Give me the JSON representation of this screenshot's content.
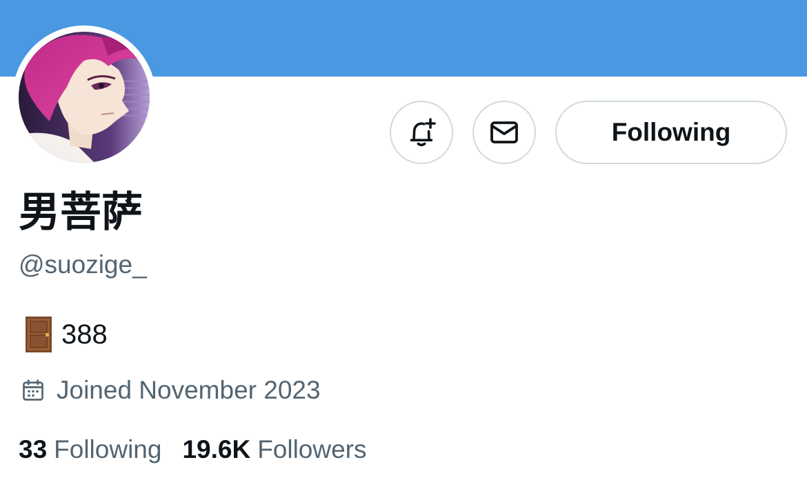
{
  "colors": {
    "banner": "#4a98e1",
    "text_primary": "#0f1419",
    "text_secondary": "#536471",
    "button_border": "#cfd9de"
  },
  "banner": {},
  "avatar": {
    "description_icon": "avatar-anime-portrait"
  },
  "actions": {
    "notify_icon": "bell-plus-icon",
    "message_icon": "envelope-icon",
    "following_label": "Following"
  },
  "profile": {
    "display_name": "男菩萨",
    "handle": "@suozige_",
    "bio_icon": "door-emoji-icon",
    "bio_text": "388",
    "joined_icon": "calendar-icon",
    "joined_text": "Joined November 2023"
  },
  "stats": {
    "following_count": "33",
    "following_label": "Following",
    "followers_count": "19.6K",
    "followers_label": "Followers"
  }
}
